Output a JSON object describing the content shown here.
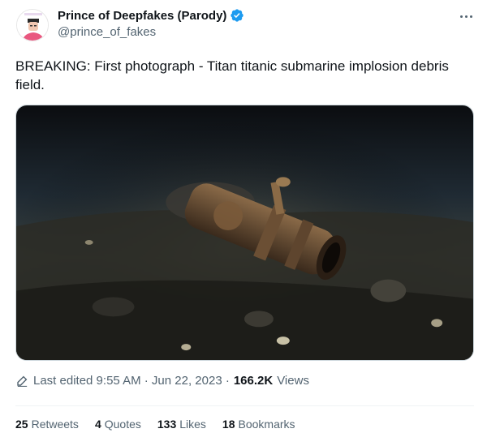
{
  "author": {
    "display_name": "Prince of Deepfakes (Parody)",
    "handle": "@prince_of_fakes",
    "verified": true,
    "avatar_label": "PRINCE OF FAKES"
  },
  "tweet": {
    "text": "BREAKING: First photograph - Titan titanic submarine implosion debris field.",
    "edited_label": "Last edited 9:55 AM · Jun 22, 2023 ·",
    "views_count": "166.2K",
    "views_label": "Views"
  },
  "stats": {
    "retweets_count": "25",
    "retweets_label": "Retweets",
    "quotes_count": "4",
    "quotes_label": "Quotes",
    "likes_count": "133",
    "likes_label": "Likes",
    "bookmarks_count": "18",
    "bookmarks_label": "Bookmarks"
  },
  "colors": {
    "accent": "#1d9bf0",
    "text": "#0f1419",
    "secondary": "#536471"
  },
  "icons": [
    "verified-badge-icon",
    "more-options-icon",
    "pencil-icon"
  ]
}
